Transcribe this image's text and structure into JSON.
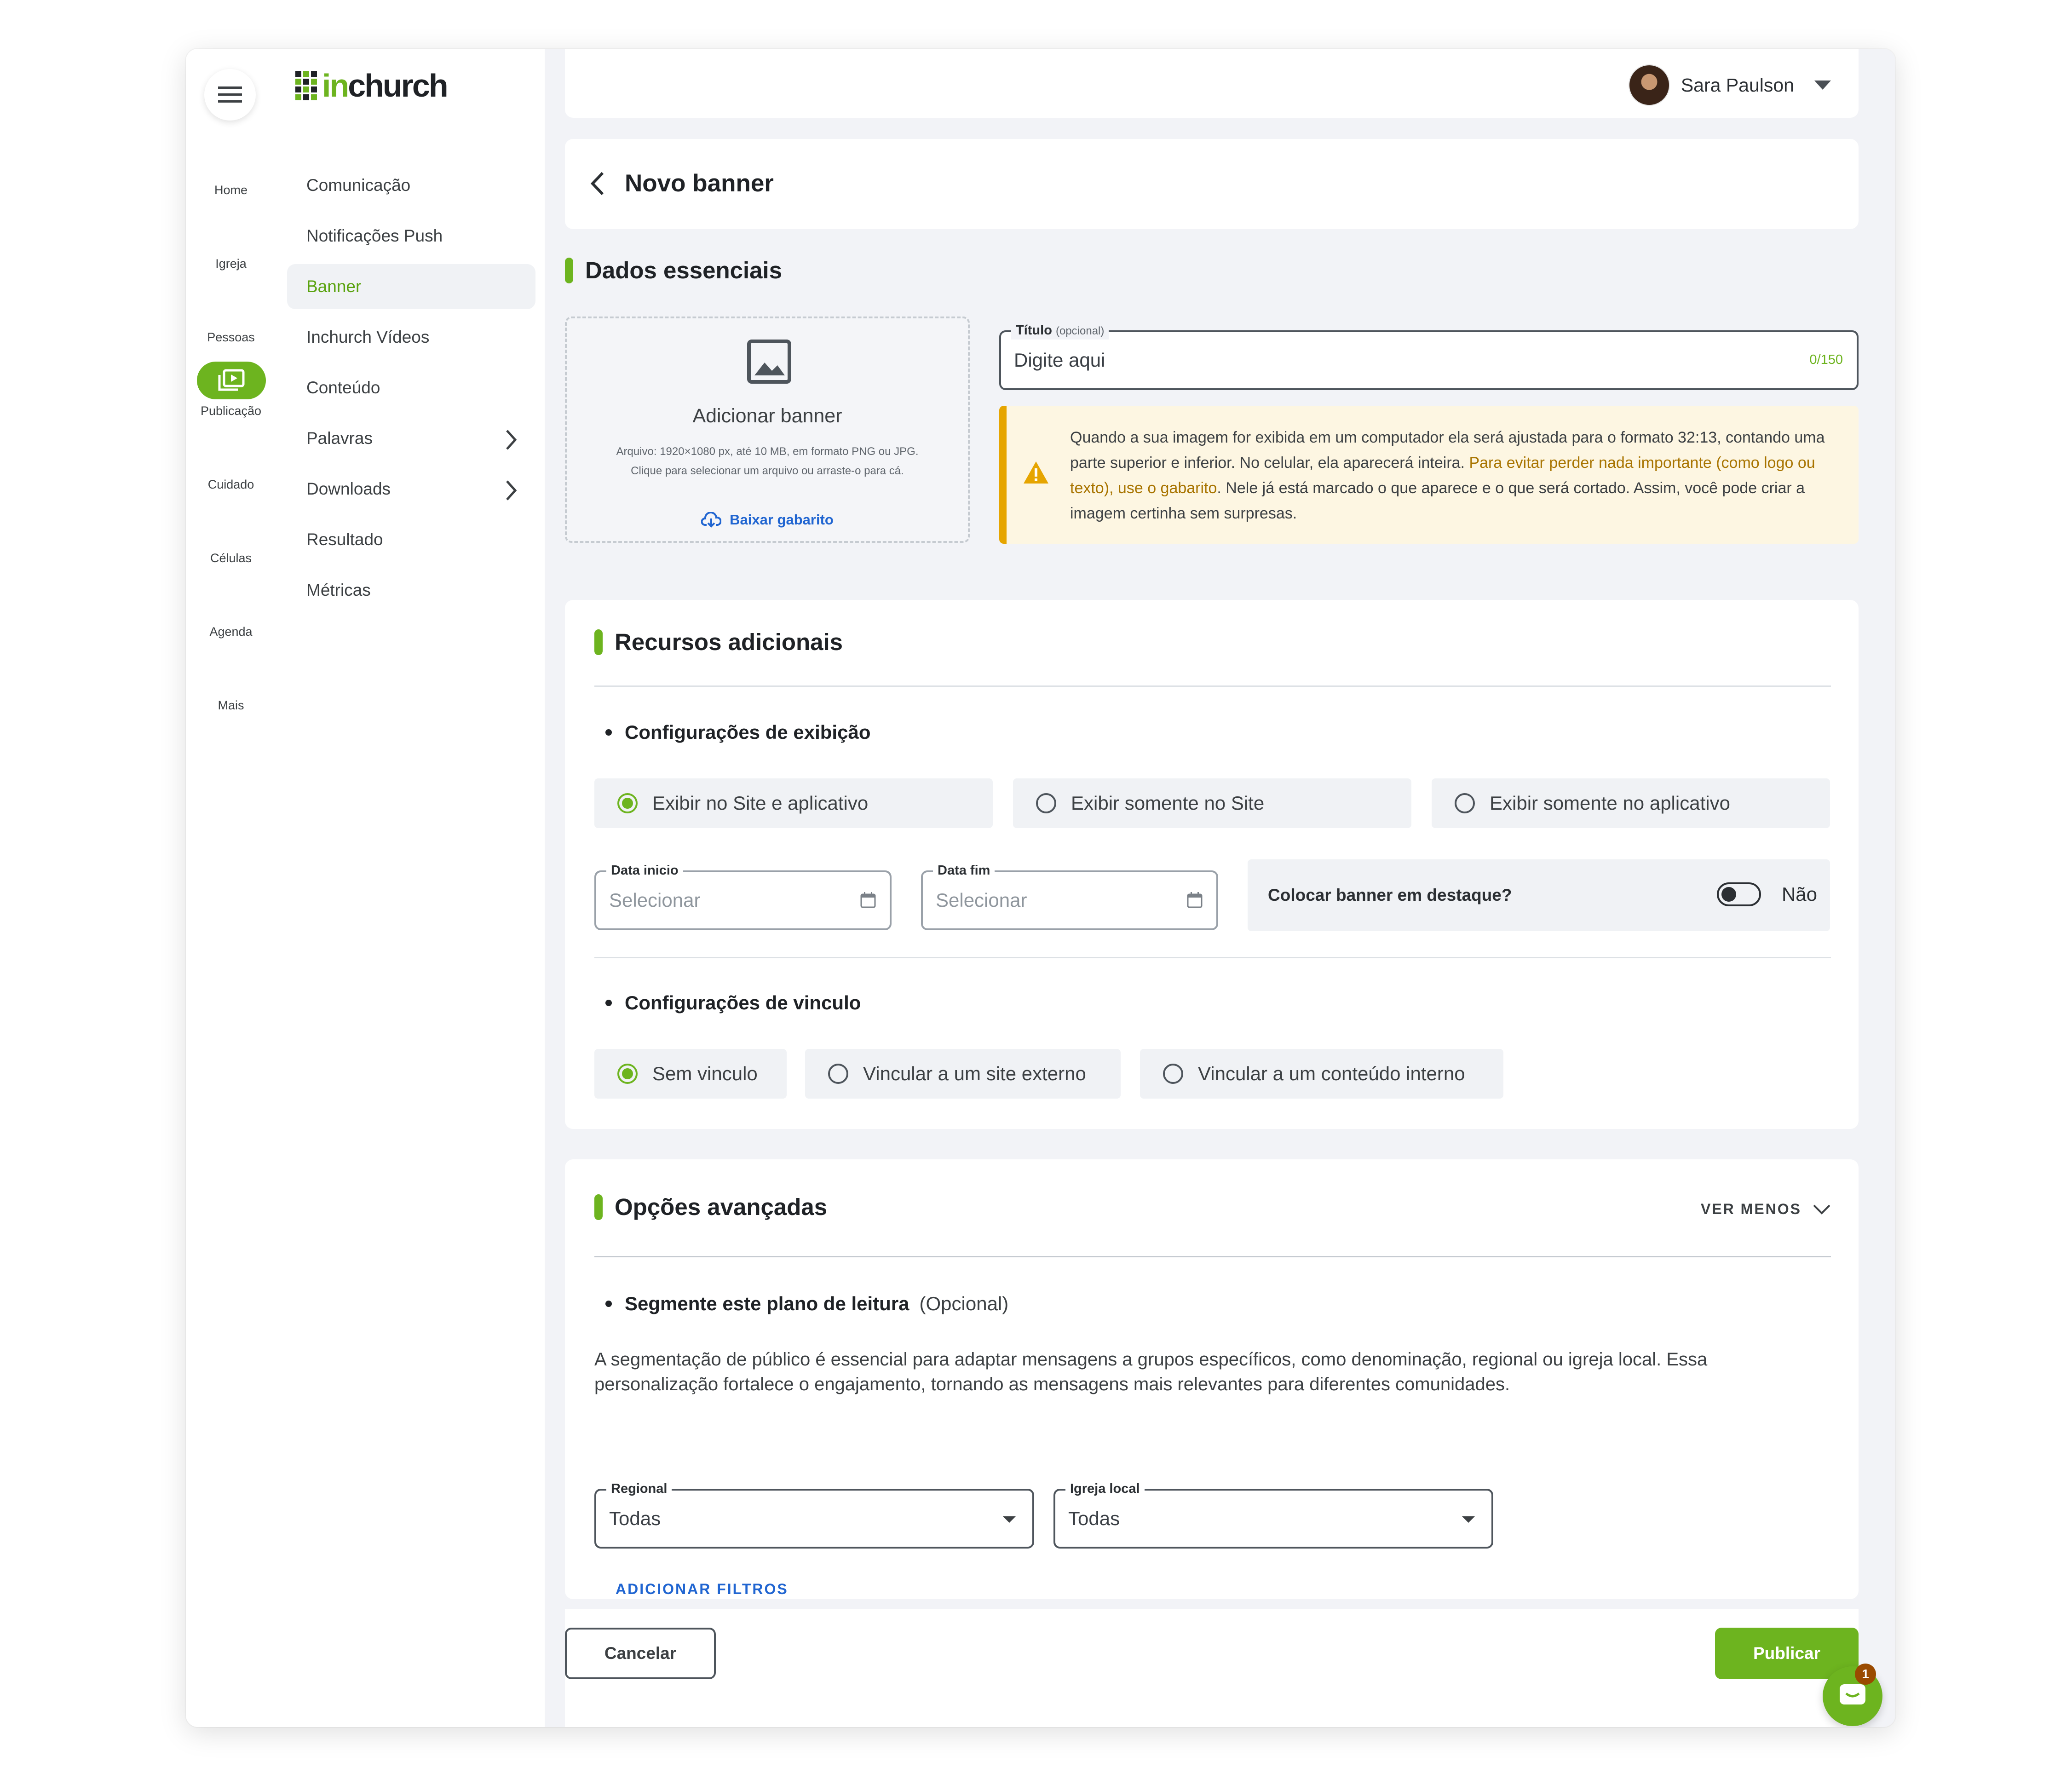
{
  "app": {
    "logo_text": "inchurch",
    "rail": [
      {
        "label": "Home"
      },
      {
        "label": "Igreja"
      },
      {
        "label": "Pessoas"
      },
      {
        "label": "Publicação"
      },
      {
        "label": "Cuidado"
      },
      {
        "label": "Células"
      },
      {
        "label": "Agenda"
      },
      {
        "label": "Mais"
      }
    ],
    "sidebar": [
      {
        "label": "Comunicação"
      },
      {
        "label": "Notificações Push"
      },
      {
        "label": "Banner"
      },
      {
        "label": "Inchurch Vídeos"
      },
      {
        "label": "Conteúdo"
      },
      {
        "label": "Palavras"
      },
      {
        "label": "Downloads"
      },
      {
        "label": "Resultado"
      },
      {
        "label": "Métricas"
      }
    ],
    "accent_color": "#6db41f"
  },
  "header": {
    "user_name": "Sara Paulson"
  },
  "page": {
    "title": "Novo banner"
  },
  "essentials": {
    "title": "Dados essenciais",
    "upload": {
      "title": "Adicionar banner",
      "hint_line1": "Arquivo: 1920×1080 px, até 10 MB, em formato PNG ou JPG.",
      "hint_line2": "Clique para selecionar um arquivo ou arraste-o para cá.",
      "template_link": "Baixar gabarito"
    },
    "title_field": {
      "label": "Título",
      "optional": "(opcional)",
      "placeholder": "Digite aqui",
      "counter": "0/150"
    },
    "alert": {
      "part1": "Quando a sua imagem for exibida em um computador ela será ajustada para o formato 32:13, contando uma parte superior e inferior. No celular, ela aparecerá inteira. ",
      "highlight": "Para evitar perder nada importante (como logo ou texto), use o gabarito",
      "part2": ". Nele já está marcado o que aparece e o que será cortado. Assim, você pode criar a imagem certinha sem surpresas."
    }
  },
  "resources": {
    "title": "Recursos adicionais",
    "display_heading": "Configurações de exibição",
    "display_options": [
      {
        "label": "Exibir no Site e aplicativo",
        "selected": true
      },
      {
        "label": "Exibir somente no Site",
        "selected": false
      },
      {
        "label": "Exibir somente no aplicativo",
        "selected": false
      }
    ],
    "start_date": {
      "label": "Data inicio",
      "placeholder": "Selecionar"
    },
    "end_date": {
      "label": "Data fim",
      "placeholder": "Selecionar"
    },
    "highlight": {
      "label": "Colocar banner em destaque?",
      "value": "Não"
    },
    "link_heading": "Configurações de vinculo",
    "link_options": [
      {
        "label": "Sem vinculo",
        "selected": true
      },
      {
        "label": "Vincular a um site externo",
        "selected": false
      },
      {
        "label": "Vincular a um conteúdo interno",
        "selected": false
      }
    ]
  },
  "advanced": {
    "title": "Opções avançadas",
    "toggle_label": "VER MENOS",
    "segment_heading": "Segmente este plano de leitura",
    "segment_optional": "(Opcional)",
    "segment_desc_line1": "A segmentação de público é essencial para adaptar mensagens a grupos específicos, como denominação, regional ou igreja local. Essa",
    "segment_desc_line2": "personalização fortalece o engajamento, tornando as mensagens mais relevantes para diferentes comunidades.",
    "regional": {
      "label": "Regional",
      "value": "Todas"
    },
    "church": {
      "label": "Igreja local",
      "value": "Todas"
    },
    "add_filters": "ADICIONAR FILTROS"
  },
  "footer": {
    "cancel": "Cancelar",
    "publish": "Publicar",
    "chat_badge": "1"
  }
}
